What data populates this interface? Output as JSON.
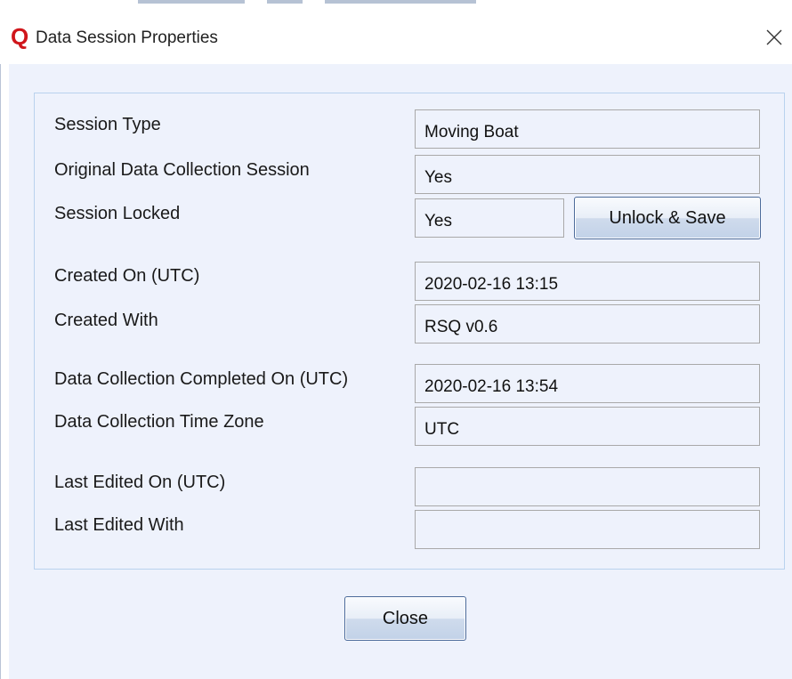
{
  "window": {
    "title": "Data Session Properties",
    "app_icon_glyph": "Q"
  },
  "properties": [
    {
      "label": "Session Type",
      "value": "Moving Boat"
    },
    {
      "label": "Original Data Collection Session",
      "value": "Yes"
    },
    {
      "label": "Session Locked",
      "value": "Yes"
    },
    {
      "label": "Created On (UTC)",
      "value": "2020-02-16 13:15"
    },
    {
      "label": "Created With",
      "value": "RSQ v0.6"
    },
    {
      "label": "Data Collection Completed On (UTC)",
      "value": "2020-02-16 13:54"
    },
    {
      "label": "Data Collection Time Zone",
      "value": "UTC"
    },
    {
      "label": "Last Edited On (UTC)",
      "value": ""
    },
    {
      "label": "Last Edited With",
      "value": ""
    }
  ],
  "buttons": {
    "unlock_save": "Unlock & Save",
    "close": "Close"
  },
  "colors": {
    "app_icon": "#d0161b",
    "client_background": "#eef2fc",
    "group_border": "#b9d2ee",
    "button_border": "#4b6a9a"
  },
  "icons": {
    "app": "q-logo-icon",
    "close": "close-icon"
  }
}
